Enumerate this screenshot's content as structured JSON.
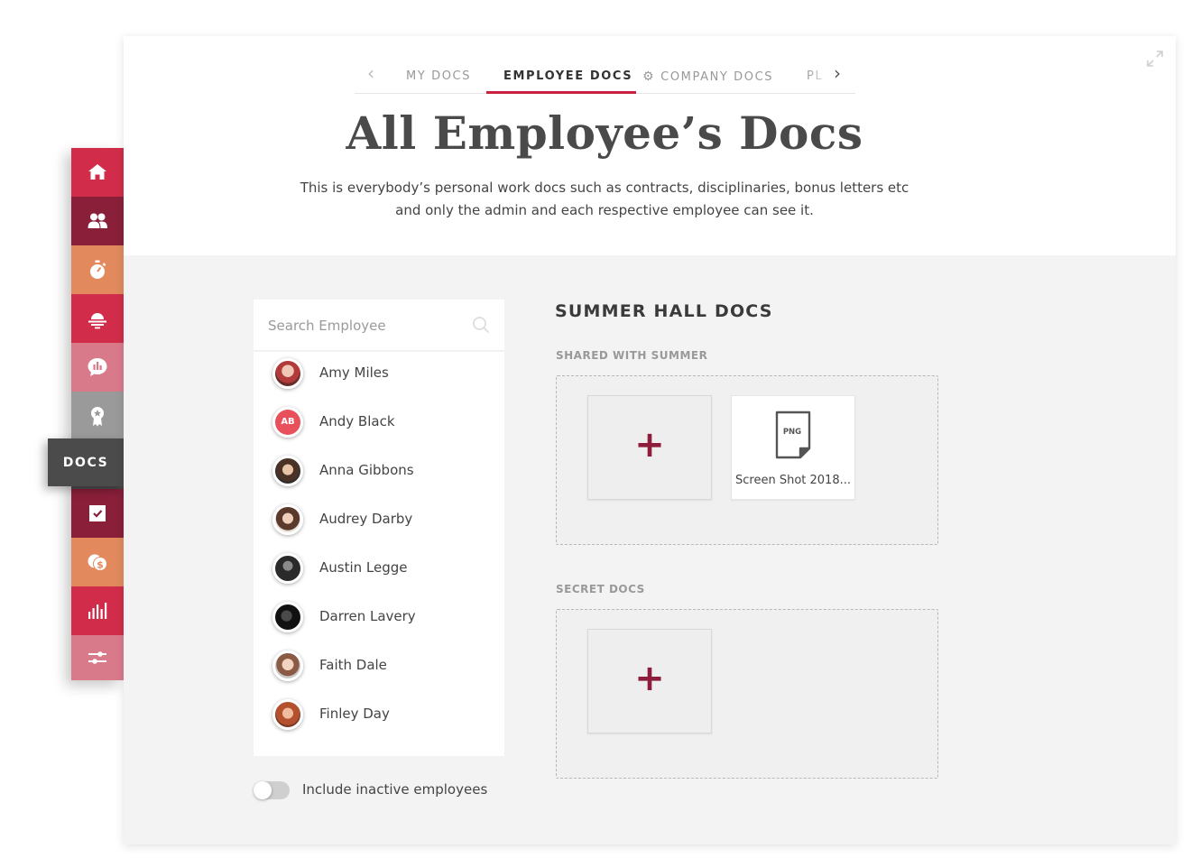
{
  "tabs": {
    "items": [
      "MY DOCS",
      "EMPLOYEE DOCS",
      "COMPANY DOCS",
      "PL"
    ],
    "active_index": 1
  },
  "header": {
    "title": "All Employee’s Docs",
    "description_line1": "This is everybody’s personal work docs such as contracts, disciplinaries, bonus letters etc",
    "description_line2": "and only the admin and each respective employee can see it."
  },
  "search": {
    "placeholder": "Search Employee"
  },
  "employees": [
    {
      "name": "Amy Miles",
      "initials": ""
    },
    {
      "name": "Andy Black",
      "initials": "AB"
    },
    {
      "name": "Anna Gibbons",
      "initials": ""
    },
    {
      "name": "Audrey Darby",
      "initials": ""
    },
    {
      "name": "Austin Legge",
      "initials": ""
    },
    {
      "name": "Darren Lavery",
      "initials": ""
    },
    {
      "name": "Faith Dale",
      "initials": ""
    },
    {
      "name": "Finley Day",
      "initials": ""
    }
  ],
  "inactive_toggle": {
    "label": "Include inactive employees",
    "on": false
  },
  "docs": {
    "title": "SUMMER HALL DOCS",
    "shared_label": "SHARED WITH SUMMER",
    "secret_label": "SECRET DOCS",
    "add_symbol": "+",
    "shared_files": [
      {
        "type": "PNG",
        "name": "Screen Shot 2018..."
      }
    ]
  },
  "sidebar": {
    "items": [
      {
        "icon": "home-icon",
        "color": "#d12d4a"
      },
      {
        "icon": "people-icon",
        "color": "#8a1f3a"
      },
      {
        "icon": "stopwatch-icon",
        "color": "#e28a5e"
      },
      {
        "icon": "sunset-icon",
        "color": "#d12d4a"
      },
      {
        "icon": "chat-chart-icon",
        "color": "#d97a8a"
      },
      {
        "icon": "award-icon",
        "color": "#9a9a9a"
      },
      {
        "icon": "docs",
        "color": "#4b4b4b"
      },
      {
        "icon": "checkbox-icon",
        "color": "#8a1f3a"
      },
      {
        "icon": "coins-icon",
        "color": "#e28a5e"
      },
      {
        "icon": "bar-chart-icon",
        "color": "#d12d4a"
      },
      {
        "icon": "sliders-icon",
        "color": "#d97a8a"
      }
    ],
    "active_label": "DOCS"
  }
}
